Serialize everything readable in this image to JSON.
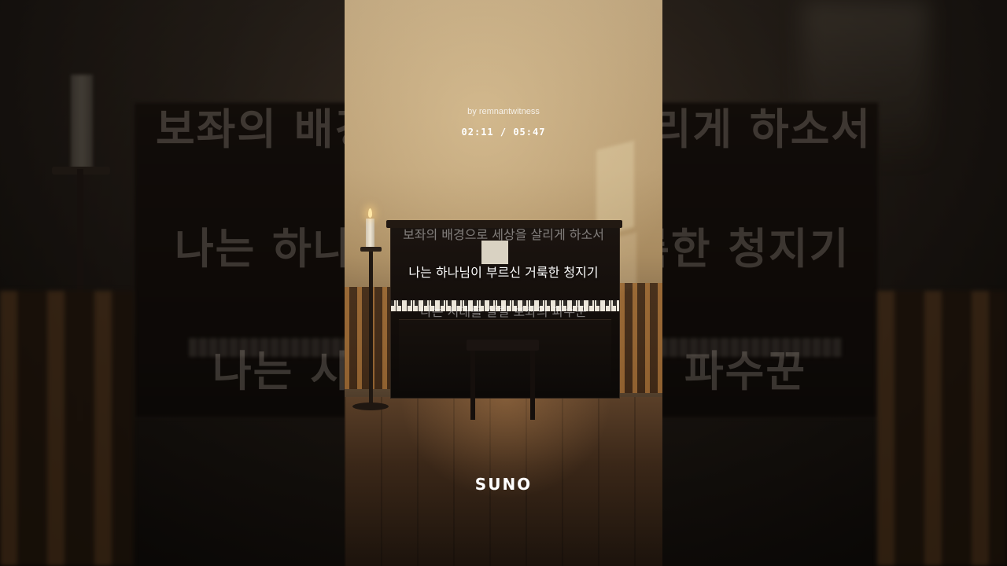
{
  "player": {
    "author": "by remnantwitness",
    "current_time": "02:11",
    "separator": "/",
    "duration": "05:47",
    "time_display": "02:11 / 05:47"
  },
  "lyrics": {
    "previous": "보좌의 배경으로 세상을 살리게 하소서",
    "current": "나는 하나님이 부르신 거룩한 청지기",
    "next": "나는 시대를 살릴 보좌의 파수꾼"
  },
  "backdrop_lyrics": {
    "line1": "보좌의 배경으로 세상을 살리게 하소서",
    "line2": "나는 하나님이 부르신 거룩한 청지기",
    "line3": "나는 시대를 살릴 보좌의 파수꾼"
  },
  "brand": {
    "logo_text": "SUNO"
  },
  "colors": {
    "lyric_active": "#ffffff",
    "lyric_inactive": "rgba(255,255,255,0.45)"
  }
}
